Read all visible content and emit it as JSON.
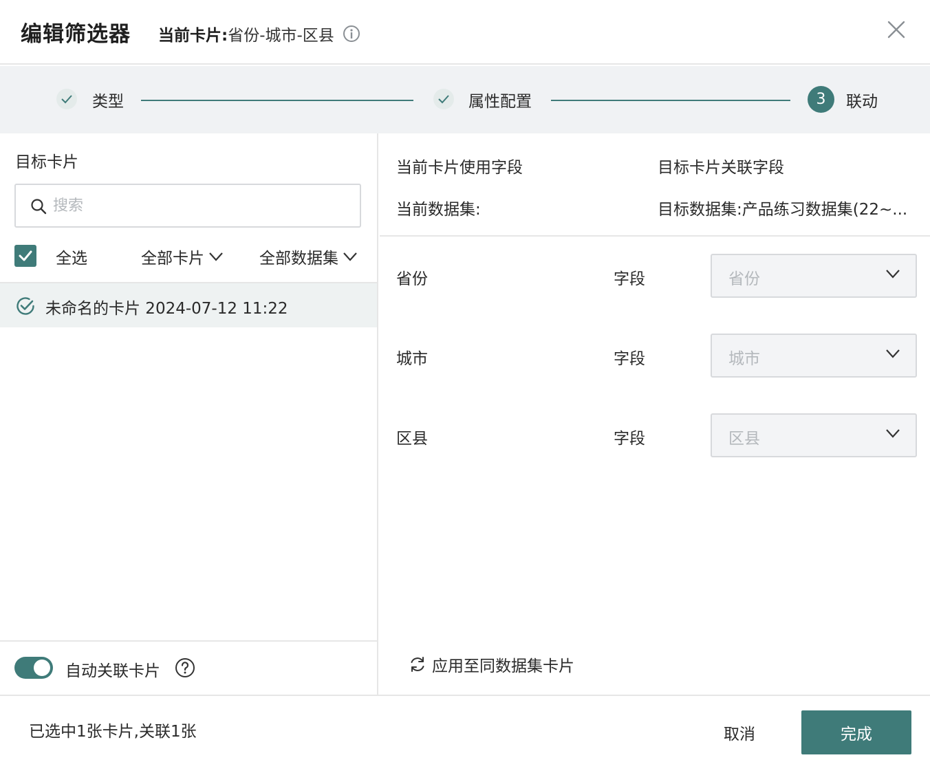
{
  "header": {
    "title": "编辑筛选器",
    "current_card_label": "当前卡片:",
    "current_card_value": "省份-城市-区县"
  },
  "steps": [
    {
      "label": "类型",
      "status": "done"
    },
    {
      "label": "属性配置",
      "status": "done"
    },
    {
      "number": "3",
      "label": "联动",
      "status": "active"
    }
  ],
  "left": {
    "title": "目标卡片",
    "search_placeholder": "搜索",
    "select_all_label": "全选",
    "select_all_checked": true,
    "filter_cards": "全部卡片",
    "filter_datasets": "全部数据集",
    "cards": [
      {
        "label": "未命名的卡片 2024-07-12 11:22",
        "selected": true
      }
    ],
    "auto_link_label": "自动关联卡片",
    "auto_link_on": true
  },
  "right": {
    "col1_header": "当前卡片使用字段",
    "col2_header": "目标卡片关联字段",
    "current_dataset_label": "当前数据集:",
    "target_dataset_label": "目标数据集:产品练习数据集(22~...",
    "rows": [
      {
        "label": "省份",
        "field": "字段",
        "value": "省份"
      },
      {
        "label": "城市",
        "field": "字段",
        "value": "城市"
      },
      {
        "label": "区县",
        "field": "字段",
        "value": "区县"
      }
    ],
    "apply_label": "应用至同数据集卡片"
  },
  "footer": {
    "status": "已选中1张卡片,关联1张",
    "cancel_label": "取消",
    "done_label": "完成"
  },
  "colors": {
    "accent": "#3f7b79",
    "step_bg": "#f0f2f4",
    "selected_row_bg": "#eef2f2"
  }
}
